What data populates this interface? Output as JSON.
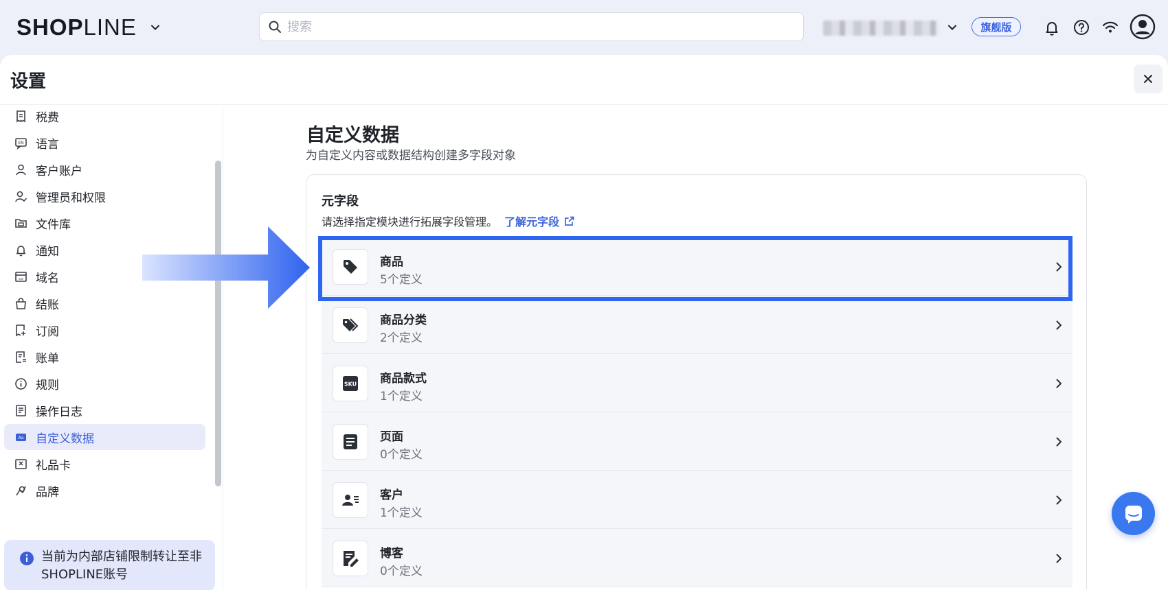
{
  "topbar": {
    "logo_text_bold": "SHOP",
    "logo_text_light": "LINE",
    "search_placeholder": "搜索",
    "plan_badge": "旗舰版"
  },
  "panel": {
    "title": "设置"
  },
  "sidebar": {
    "items": [
      {
        "label": "税费",
        "icon": "receipt-icon"
      },
      {
        "label": "语言",
        "icon": "language-icon"
      },
      {
        "label": "客户账户",
        "icon": "user-icon"
      },
      {
        "label": "管理员和权限",
        "icon": "admin-user-icon"
      },
      {
        "label": "文件库",
        "icon": "folder-icon"
      },
      {
        "label": "通知",
        "icon": "bell-icon"
      },
      {
        "label": "域名",
        "icon": "domain-icon"
      },
      {
        "label": "结账",
        "icon": "shopping-bag-icon"
      },
      {
        "label": "订阅",
        "icon": "subscription-icon"
      },
      {
        "label": "账单",
        "icon": "bill-icon"
      },
      {
        "label": "规则",
        "icon": "info-icon"
      },
      {
        "label": "操作日志",
        "icon": "log-icon"
      },
      {
        "label": "自定义数据",
        "icon": "custom-data-icon",
        "active": true
      },
      {
        "label": "礼品卡",
        "icon": "gift-card-icon"
      },
      {
        "label": "品牌",
        "icon": "brand-icon"
      }
    ],
    "notice": "当前为内部店铺限制转让至非SHOPLINE账号"
  },
  "main": {
    "title": "自定义数据",
    "subtitle": "为自定义内容或数据结构创建多字段对象",
    "card": {
      "title": "元字段",
      "description": "请选择指定模块进行拓展字段管理。",
      "link": "了解元字段",
      "rows": [
        {
          "name": "商品",
          "count": "5个定义",
          "icon": "tag-icon"
        },
        {
          "name": "商品分类",
          "count": "2个定义",
          "icon": "tags-icon"
        },
        {
          "name": "商品款式",
          "count": "1个定义",
          "icon": "sku-icon"
        },
        {
          "name": "页面",
          "count": "0个定义",
          "icon": "page-icon"
        },
        {
          "name": "客户",
          "count": "1个定义",
          "icon": "customer-card-icon"
        },
        {
          "name": "博客",
          "count": "0个定义",
          "icon": "blog-edit-icon"
        }
      ]
    }
  },
  "colors": {
    "accent": "#3c63db",
    "highlight": "#2e66ef",
    "active_bg": "#e9ebfb"
  }
}
